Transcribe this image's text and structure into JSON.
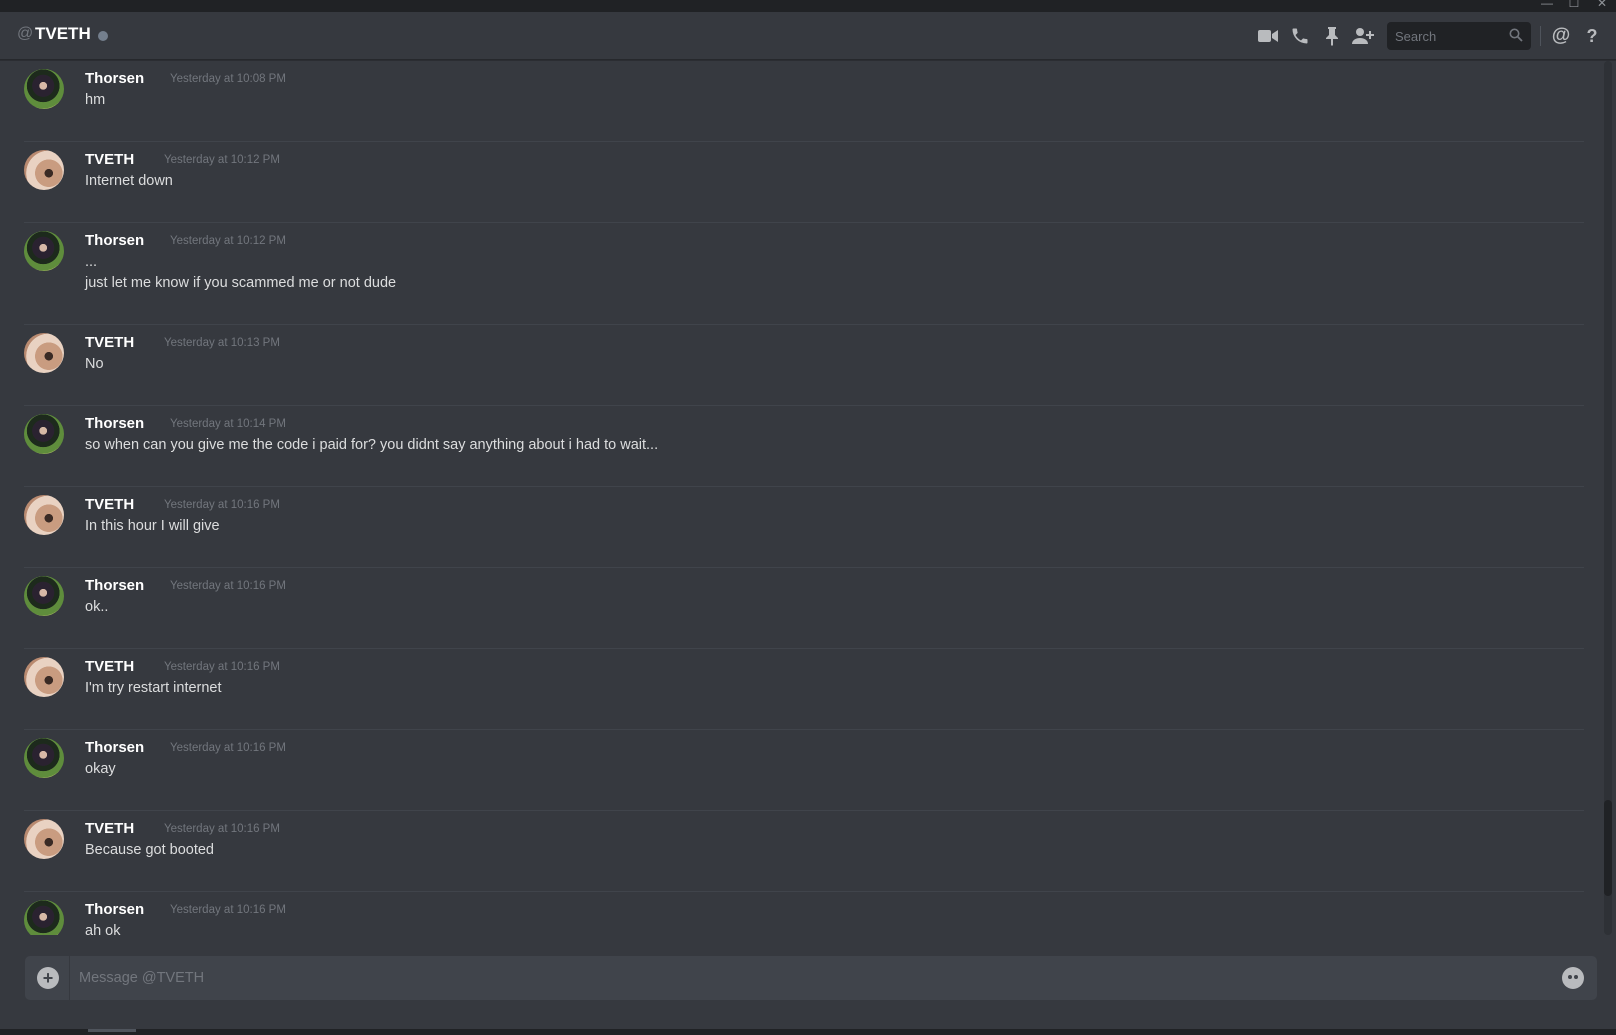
{
  "window": {
    "minimize_glyph": "—",
    "maximize_glyph": "☐",
    "close_glyph": "✕"
  },
  "header": {
    "at": "@",
    "name": "TVETH",
    "status": "offline",
    "icons": [
      "video-camera-icon",
      "phone-icon",
      "pin-icon",
      "add-friend-icon",
      "mention-icon",
      "help-icon"
    ],
    "search_placeholder": "Search",
    "mention_glyph": "@",
    "help_glyph": "?"
  },
  "messages": [
    {
      "author": "Thorsen",
      "avatar": "thorsen",
      "time": "Yesterday at 10:08 PM",
      "lines": [
        "hm"
      ]
    },
    {
      "author": "TVETH",
      "avatar": "tveth",
      "time": "Yesterday at 10:12 PM",
      "lines": [
        "Internet down"
      ]
    },
    {
      "author": "Thorsen",
      "avatar": "thorsen",
      "time": "Yesterday at 10:12 PM",
      "lines": [
        "...",
        "just let me know if you scammed me or not dude"
      ]
    },
    {
      "author": "TVETH",
      "avatar": "tveth",
      "time": "Yesterday at 10:13 PM",
      "lines": [
        "No"
      ]
    },
    {
      "author": "Thorsen",
      "avatar": "thorsen",
      "time": "Yesterday at 10:14 PM",
      "lines": [
        "so when can you give me the code i paid for? you didnt say anything about i had to wait..."
      ]
    },
    {
      "author": "TVETH",
      "avatar": "tveth",
      "time": "Yesterday at 10:16 PM",
      "lines": [
        "In this hour I will give"
      ]
    },
    {
      "author": "Thorsen",
      "avatar": "thorsen",
      "time": "Yesterday at 10:16 PM",
      "lines": [
        "ok.."
      ]
    },
    {
      "author": "TVETH",
      "avatar": "tveth",
      "time": "Yesterday at 10:16 PM",
      "lines": [
        "I'm try restart internet"
      ]
    },
    {
      "author": "Thorsen",
      "avatar": "thorsen",
      "time": "Yesterday at 10:16 PM",
      "lines": [
        "okay"
      ]
    },
    {
      "author": "TVETH",
      "avatar": "tveth",
      "time": "Yesterday at 10:16 PM",
      "lines": [
        "Because got booted"
      ]
    },
    {
      "author": "Thorsen",
      "avatar": "thorsen",
      "time": "Yesterday at 10:16 PM",
      "lines": [
        "ah ok"
      ]
    }
  ],
  "composer": {
    "placeholder": "Message @TVETH",
    "attach_glyph": "+"
  },
  "colors": {
    "background": "#36393f",
    "text": "#dcddde",
    "muted": "#72767d",
    "input": "#40444b",
    "status_offline": "#747f8d"
  }
}
